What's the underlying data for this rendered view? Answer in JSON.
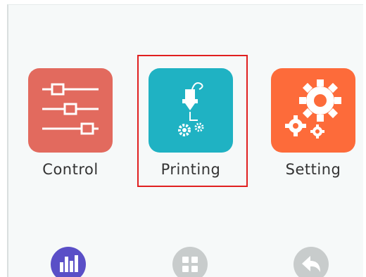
{
  "menu": {
    "tiles": [
      {
        "label": "Control",
        "icon": "sliders-icon",
        "color": "#e26a5e"
      },
      {
        "label": "Printing",
        "icon": "printhead-gears-icon",
        "color": "#1fb2c3",
        "selected": true
      },
      {
        "label": "Setting",
        "icon": "gears-icon",
        "color": "#fd6b3a"
      }
    ]
  },
  "bottom_nav": {
    "items": [
      {
        "icon": "bar-chart-icon",
        "color": "#5a4fc7"
      },
      {
        "icon": "grid-icon",
        "color": "#c8cccc"
      },
      {
        "icon": "back-arrow-icon",
        "color": "#c8cccc"
      }
    ]
  },
  "selection_color": "#e02020"
}
